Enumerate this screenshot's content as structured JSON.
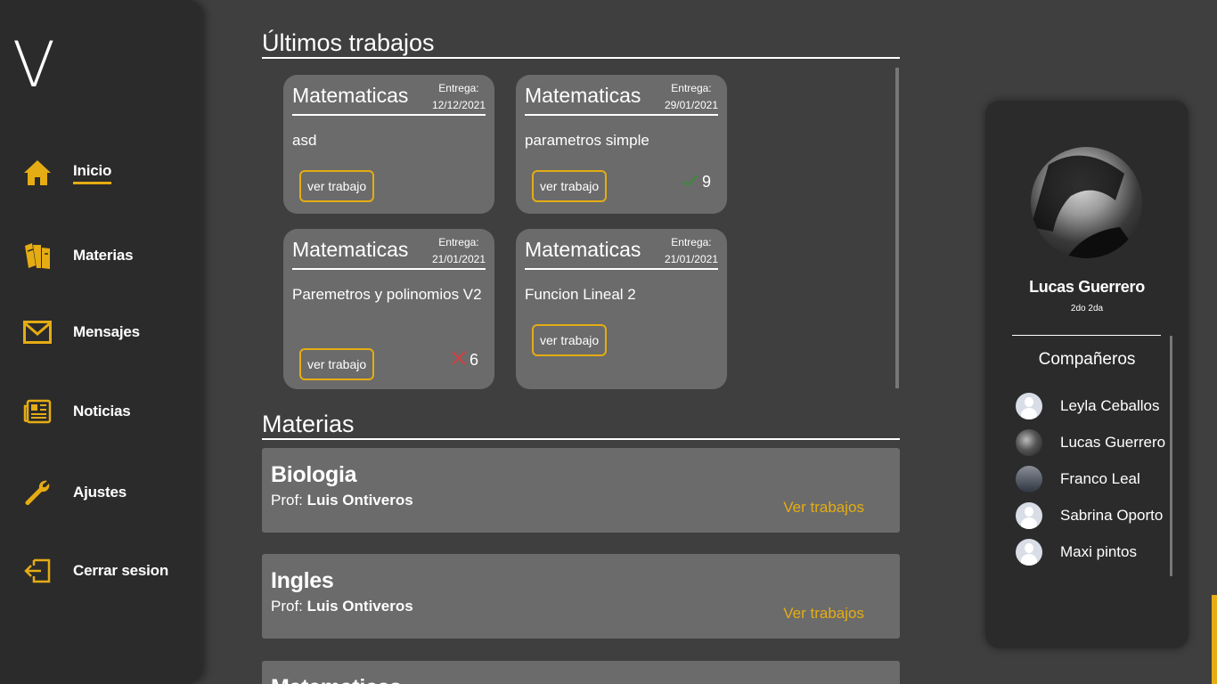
{
  "logo": "V",
  "colors": {
    "accent": "#e5ac13",
    "sidebar": "#2b2b2b",
    "card": "#6b6b6b",
    "background": "#3f3f3f",
    "check": "#3a8a3a",
    "cross": "#d04040"
  },
  "sidebar": {
    "items": [
      {
        "label": "Inicio",
        "icon": "home-icon",
        "active": true
      },
      {
        "label": "Materias",
        "icon": "books-icon",
        "active": false
      },
      {
        "label": "Mensajes",
        "icon": "mail-icon",
        "active": false
      },
      {
        "label": "Noticias",
        "icon": "newspaper-icon",
        "active": false
      },
      {
        "label": "Ajustes",
        "icon": "wrench-icon",
        "active": false
      },
      {
        "label": "Cerrar sesion",
        "icon": "logout-icon",
        "active": false
      }
    ]
  },
  "works": {
    "title": "Últimos trabajos",
    "cards": [
      {
        "subject": "Matematicas",
        "due_label": "Entrega:",
        "due_date": "12/12/2021",
        "description": "asd",
        "button": "ver trabajo",
        "grade": "",
        "status": ""
      },
      {
        "subject": "Matematicas",
        "due_label": "Entrega:",
        "due_date": "29/01/2021",
        "description": "parametros simple",
        "button": "ver trabajo",
        "grade": "9",
        "status": "check-icon"
      },
      {
        "subject": "Matematicas",
        "due_label": "Entrega:",
        "due_date": "21/01/2021",
        "description": "Paremetros y polinomios V2",
        "button": "ver trabajo",
        "grade": "6",
        "status": "cross-icon"
      },
      {
        "subject": "Matematicas",
        "due_label": "Entrega:",
        "due_date": "21/01/2021",
        "description": "Funcion Lineal 2",
        "button": "ver trabajo",
        "grade": "",
        "status": ""
      }
    ]
  },
  "subjects": {
    "title": "Materias",
    "items": [
      {
        "name": "Biologia",
        "prof_label": "Prof:",
        "prof_name": "Luis Ontiveros",
        "link": "Ver trabajos"
      },
      {
        "name": "Ingles",
        "prof_label": "Prof:",
        "prof_name": "Luis Ontiveros",
        "link": "Ver trabajos"
      },
      {
        "name": "Matematicas",
        "prof_label": "",
        "prof_name": "",
        "link": ""
      }
    ]
  },
  "profile": {
    "name": "Lucas Guerrero",
    "course": "2do 2da",
    "companions_title": "Compañeros",
    "companions": [
      {
        "name": "Leyla Ceballos",
        "avatar": "default-avatar"
      },
      {
        "name": "Lucas Guerrero",
        "avatar": "photo-avatar"
      },
      {
        "name": "Franco Leal",
        "avatar": "photo-avatar"
      },
      {
        "name": "Sabrina Oporto",
        "avatar": "default-avatar"
      },
      {
        "name": "Maxi pintos",
        "avatar": "default-avatar"
      }
    ]
  }
}
